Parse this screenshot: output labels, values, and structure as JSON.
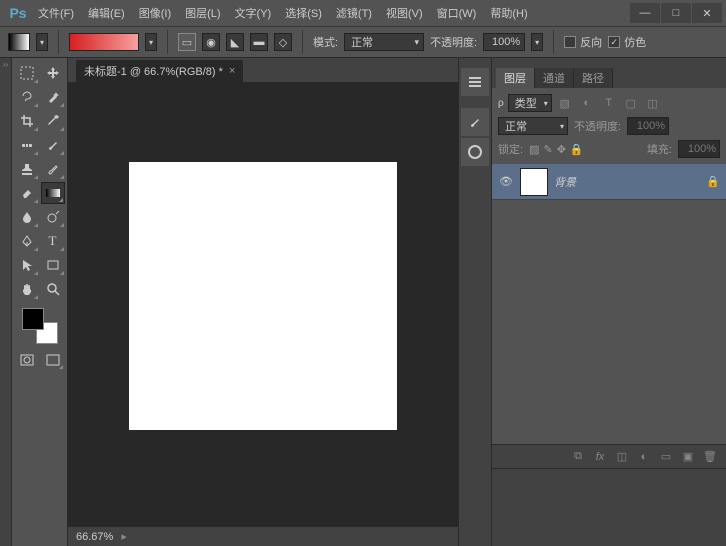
{
  "app": {
    "logo": "Ps"
  },
  "menu": [
    "文件(F)",
    "编辑(E)",
    "图像(I)",
    "图层(L)",
    "文字(Y)",
    "选择(S)",
    "滤镜(T)",
    "视图(V)",
    "窗口(W)",
    "帮助(H)"
  ],
  "options": {
    "mode_label": "模式:",
    "mode_value": "正常",
    "opacity_label": "不透明度:",
    "opacity_value": "100%",
    "reverse_label": "反向",
    "dither_label": "仿色"
  },
  "document": {
    "tab_title": "未标题-1 @ 66.7%(RGB/8) *",
    "zoom": "66.67%"
  },
  "layers_panel": {
    "tabs": [
      "图层",
      "通道",
      "路径"
    ],
    "kind_label": "类型",
    "blend_mode": "正常",
    "opacity_label": "不透明度:",
    "opacity_value": "100%",
    "lock_label": "锁定:",
    "fill_label": "填充:",
    "fill_value": "100%",
    "layers": [
      {
        "name": "背景",
        "locked": true
      }
    ]
  }
}
